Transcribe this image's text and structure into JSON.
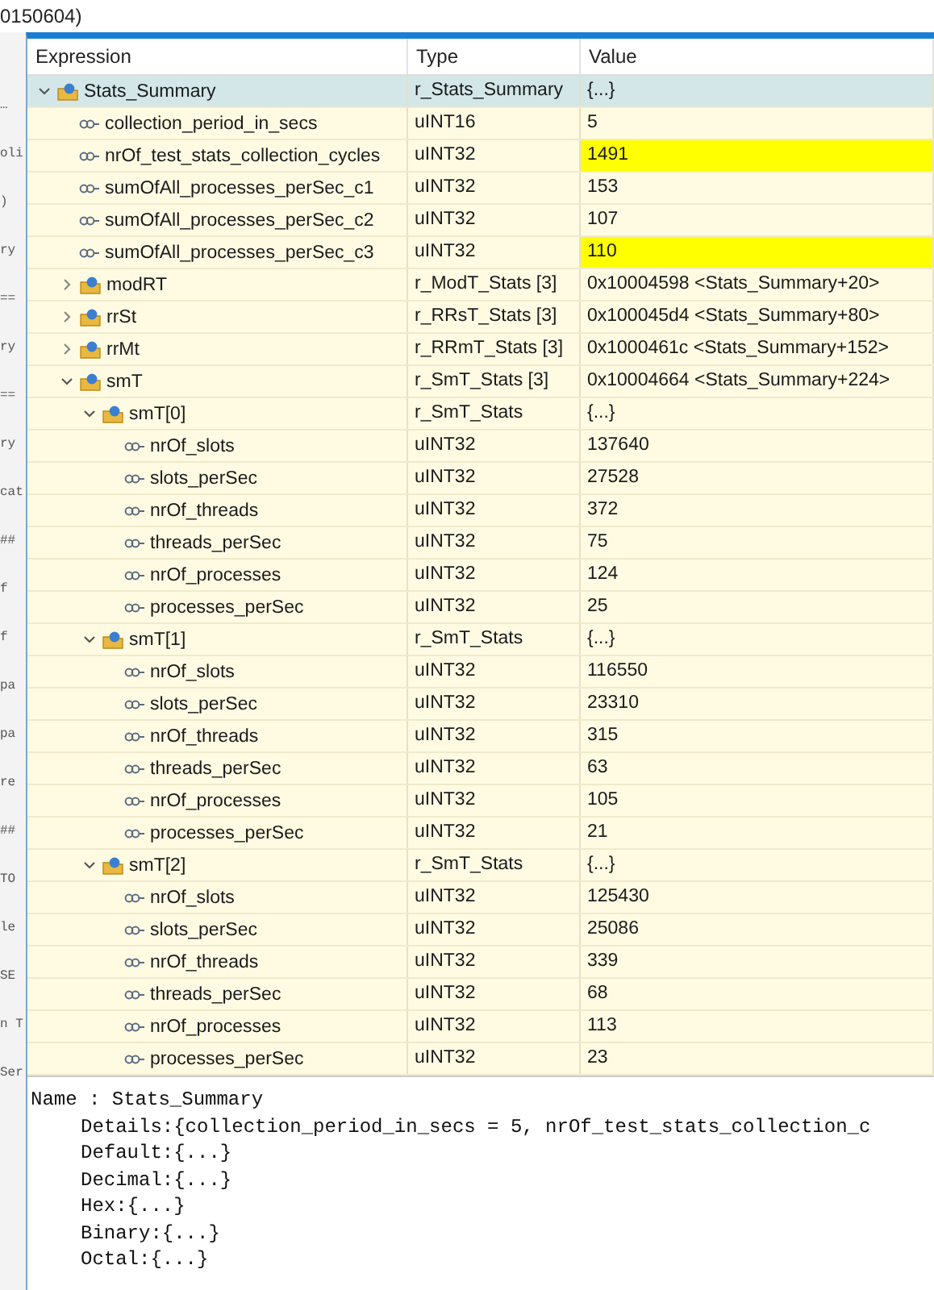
{
  "background_editor": {
    "top_text": "0150604)",
    "fragments": [
      "…",
      "oli",
      ")",
      "ry",
      "==",
      "ry",
      "==",
      "ry",
      "cat",
      "##",
      "f",
      "f",
      "pa",
      "pa",
      "re",
      "##",
      "TO",
      "le",
      "SE",
      "n T",
      "Ser"
    ]
  },
  "expressions_view": {
    "columns": [
      "Expression",
      "Type",
      "Value"
    ],
    "rows": [
      {
        "kind": "struct",
        "expression": "Stats_Summary",
        "type": "r_Stats_Summary",
        "value": "{...}",
        "expanded": true,
        "selected": true,
        "changed": false,
        "children": [
          {
            "kind": "field",
            "expression": "collection_period_in_secs",
            "type": "uINT16",
            "value": "5",
            "selected": false,
            "changed": false
          },
          {
            "kind": "field",
            "expression": "nrOf_test_stats_collection_cycles",
            "type": "uINT32",
            "value": "1491",
            "selected": false,
            "changed": true
          },
          {
            "kind": "field",
            "expression": "sumOfAll_processes_perSec_c1",
            "type": "uINT32",
            "value": "153",
            "selected": false,
            "changed": false
          },
          {
            "kind": "field",
            "expression": "sumOfAll_processes_perSec_c2",
            "type": "uINT32",
            "value": "107",
            "selected": false,
            "changed": false
          },
          {
            "kind": "field",
            "expression": "sumOfAll_processes_perSec_c3",
            "type": "uINT32",
            "value": "110",
            "selected": false,
            "changed": true
          },
          {
            "kind": "struct",
            "expression": "modRT",
            "type": "r_ModT_Stats [3]",
            "value": "0x10004598 <Stats_Summary+20>",
            "expanded": false,
            "selected": false,
            "changed": false
          },
          {
            "kind": "struct",
            "expression": "rrSt",
            "type": "r_RRsT_Stats [3]",
            "value": "0x100045d4 <Stats_Summary+80>",
            "expanded": false,
            "selected": false,
            "changed": false
          },
          {
            "kind": "struct",
            "expression": "rrMt",
            "type": "r_RRmT_Stats [3]",
            "value": "0x1000461c <Stats_Summary+152>",
            "expanded": false,
            "selected": false,
            "changed": false
          },
          {
            "kind": "struct",
            "expression": "smT",
            "type": "r_SmT_Stats [3]",
            "value": "0x10004664 <Stats_Summary+224>",
            "expanded": true,
            "selected": false,
            "changed": false,
            "children": [
              {
                "kind": "struct",
                "expression": "smT[0]",
                "type": "r_SmT_Stats",
                "value": "{...}",
                "expanded": true,
                "selected": false,
                "changed": false,
                "children": [
                  {
                    "kind": "field",
                    "expression": "nrOf_slots",
                    "type": "uINT32",
                    "value": "137640",
                    "selected": false,
                    "changed": false
                  },
                  {
                    "kind": "field",
                    "expression": "slots_perSec",
                    "type": "uINT32",
                    "value": "27528",
                    "selected": false,
                    "changed": false
                  },
                  {
                    "kind": "field",
                    "expression": "nrOf_threads",
                    "type": "uINT32",
                    "value": "372",
                    "selected": false,
                    "changed": false
                  },
                  {
                    "kind": "field",
                    "expression": "threads_perSec",
                    "type": "uINT32",
                    "value": "75",
                    "selected": false,
                    "changed": false
                  },
                  {
                    "kind": "field",
                    "expression": "nrOf_processes",
                    "type": "uINT32",
                    "value": "124",
                    "selected": false,
                    "changed": false
                  },
                  {
                    "kind": "field",
                    "expression": "processes_perSec",
                    "type": "uINT32",
                    "value": "25",
                    "selected": false,
                    "changed": false
                  }
                ]
              },
              {
                "kind": "struct",
                "expression": "smT[1]",
                "type": "r_SmT_Stats",
                "value": "{...}",
                "expanded": true,
                "selected": false,
                "changed": false,
                "children": [
                  {
                    "kind": "field",
                    "expression": "nrOf_slots",
                    "type": "uINT32",
                    "value": "116550",
                    "selected": false,
                    "changed": false
                  },
                  {
                    "kind": "field",
                    "expression": "slots_perSec",
                    "type": "uINT32",
                    "value": "23310",
                    "selected": false,
                    "changed": false
                  },
                  {
                    "kind": "field",
                    "expression": "nrOf_threads",
                    "type": "uINT32",
                    "value": "315",
                    "selected": false,
                    "changed": false
                  },
                  {
                    "kind": "field",
                    "expression": "threads_perSec",
                    "type": "uINT32",
                    "value": "63",
                    "selected": false,
                    "changed": false
                  },
                  {
                    "kind": "field",
                    "expression": "nrOf_processes",
                    "type": "uINT32",
                    "value": "105",
                    "selected": false,
                    "changed": false
                  },
                  {
                    "kind": "field",
                    "expression": "processes_perSec",
                    "type": "uINT32",
                    "value": "21",
                    "selected": false,
                    "changed": false
                  }
                ]
              },
              {
                "kind": "struct",
                "expression": "smT[2]",
                "type": "r_SmT_Stats",
                "value": "{...}",
                "expanded": true,
                "selected": false,
                "changed": false,
                "children": [
                  {
                    "kind": "field",
                    "expression": "nrOf_slots",
                    "type": "uINT32",
                    "value": "125430",
                    "selected": false,
                    "changed": false
                  },
                  {
                    "kind": "field",
                    "expression": "slots_perSec",
                    "type": "uINT32",
                    "value": "25086",
                    "selected": false,
                    "changed": false
                  },
                  {
                    "kind": "field",
                    "expression": "nrOf_threads",
                    "type": "uINT32",
                    "value": "339",
                    "selected": false,
                    "changed": false
                  },
                  {
                    "kind": "field",
                    "expression": "threads_perSec",
                    "type": "uINT32",
                    "value": "68",
                    "selected": false,
                    "changed": false
                  },
                  {
                    "kind": "field",
                    "expression": "nrOf_processes",
                    "type": "uINT32",
                    "value": "113",
                    "selected": false,
                    "changed": false
                  },
                  {
                    "kind": "field",
                    "expression": "processes_perSec",
                    "type": "uINT32",
                    "value": "23",
                    "selected": false,
                    "changed": false
                  }
                ]
              }
            ]
          }
        ]
      }
    ]
  },
  "details_pane": {
    "name_line": "Name : Stats_Summary",
    "lines": [
      "Details:{collection_period_in_secs = 5, nrOf_test_stats_collection_c",
      "Default:{...}",
      "Decimal:{...}",
      "Hex:{...}",
      "Binary:{...}",
      "Octal:{...}"
    ]
  }
}
